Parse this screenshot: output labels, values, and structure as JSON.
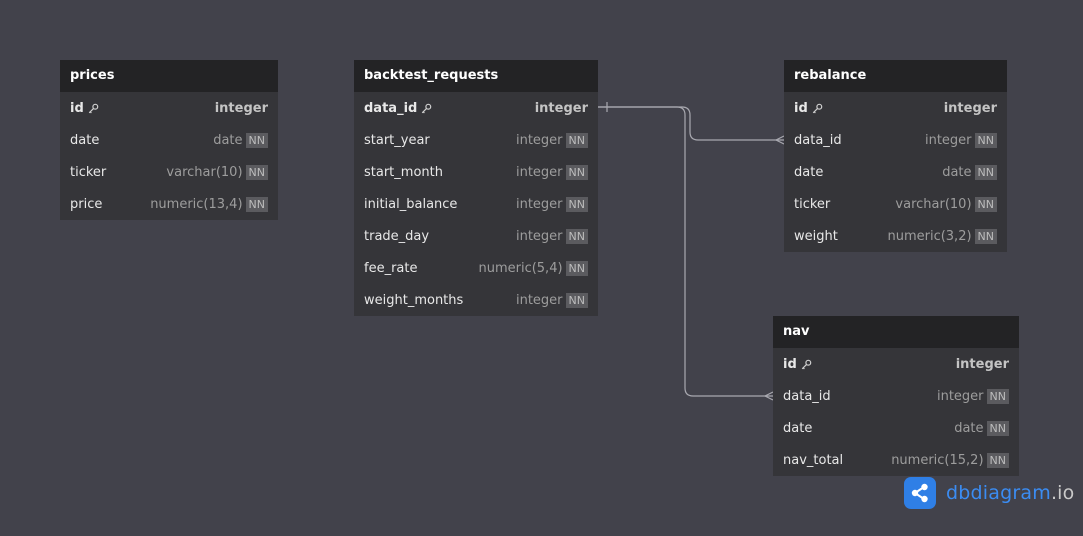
{
  "tables": {
    "prices": {
      "name": "prices",
      "fields": [
        {
          "name": "id",
          "type": "integer",
          "pk": true
        },
        {
          "name": "date",
          "type": "date",
          "nn": "NN"
        },
        {
          "name": "ticker",
          "type": "varchar(10)",
          "nn": "NN"
        },
        {
          "name": "price",
          "type": "numeric(13,4)",
          "nn": "NN"
        }
      ]
    },
    "backtest_requests": {
      "name": "backtest_requests",
      "fields": [
        {
          "name": "data_id",
          "type": "integer",
          "pk": true
        },
        {
          "name": "start_year",
          "type": "integer",
          "nn": "NN"
        },
        {
          "name": "start_month",
          "type": "integer",
          "nn": "NN"
        },
        {
          "name": "initial_balance",
          "type": "integer",
          "nn": "NN"
        },
        {
          "name": "trade_day",
          "type": "integer",
          "nn": "NN"
        },
        {
          "name": "fee_rate",
          "type": "numeric(5,4)",
          "nn": "NN"
        },
        {
          "name": "weight_months",
          "type": "integer",
          "nn": "NN"
        }
      ]
    },
    "rebalance": {
      "name": "rebalance",
      "fields": [
        {
          "name": "id",
          "type": "integer",
          "pk": true
        },
        {
          "name": "data_id",
          "type": "integer",
          "nn": "NN"
        },
        {
          "name": "date",
          "type": "date",
          "nn": "NN"
        },
        {
          "name": "ticker",
          "type": "varchar(10)",
          "nn": "NN"
        },
        {
          "name": "weight",
          "type": "numeric(3,2)",
          "nn": "NN"
        }
      ]
    },
    "nav": {
      "name": "nav",
      "fields": [
        {
          "name": "id",
          "type": "integer",
          "pk": true
        },
        {
          "name": "data_id",
          "type": "integer",
          "nn": "NN"
        },
        {
          "name": "date",
          "type": "date",
          "nn": "NN"
        },
        {
          "name": "nav_total",
          "type": "numeric(15,2)",
          "nn": "NN"
        }
      ]
    }
  },
  "relationships": [
    {
      "from": "backtest_requests.data_id",
      "to": "rebalance.data_id",
      "from_cardinality": "one",
      "to_cardinality": "many"
    },
    {
      "from": "backtest_requests.data_id",
      "to": "nav.data_id",
      "from_cardinality": "one",
      "to_cardinality": "many"
    }
  ],
  "colors": {
    "canvas": "#42424b",
    "table_header": "#232325",
    "table_body": "#353539",
    "connector": "#a9a9b0",
    "brand": "#2f7fe6"
  },
  "brand": {
    "name": "dbdiagram",
    "ext": ".io",
    "icon": "share-icon"
  }
}
